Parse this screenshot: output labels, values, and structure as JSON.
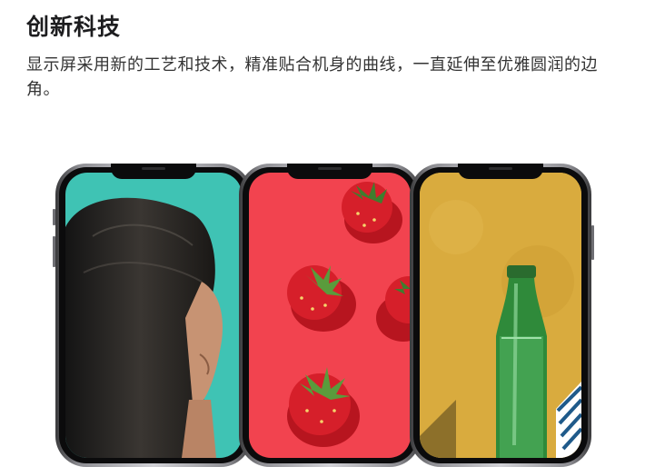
{
  "section": {
    "title": "创新科技",
    "description": "显示屏采用新的工艺和技术，精准贴合机身的曲线，一直延伸至优雅圆润的边角。"
  },
  "phones": [
    {
      "screen": "woman-portrait-teal-background"
    },
    {
      "screen": "strawberries-red-background"
    },
    {
      "screen": "green-bottle-yellow-wall"
    }
  ],
  "colors": {
    "teal": "#3fc3b4",
    "red": "#f2434f",
    "mustard": "#d9ab3e"
  }
}
